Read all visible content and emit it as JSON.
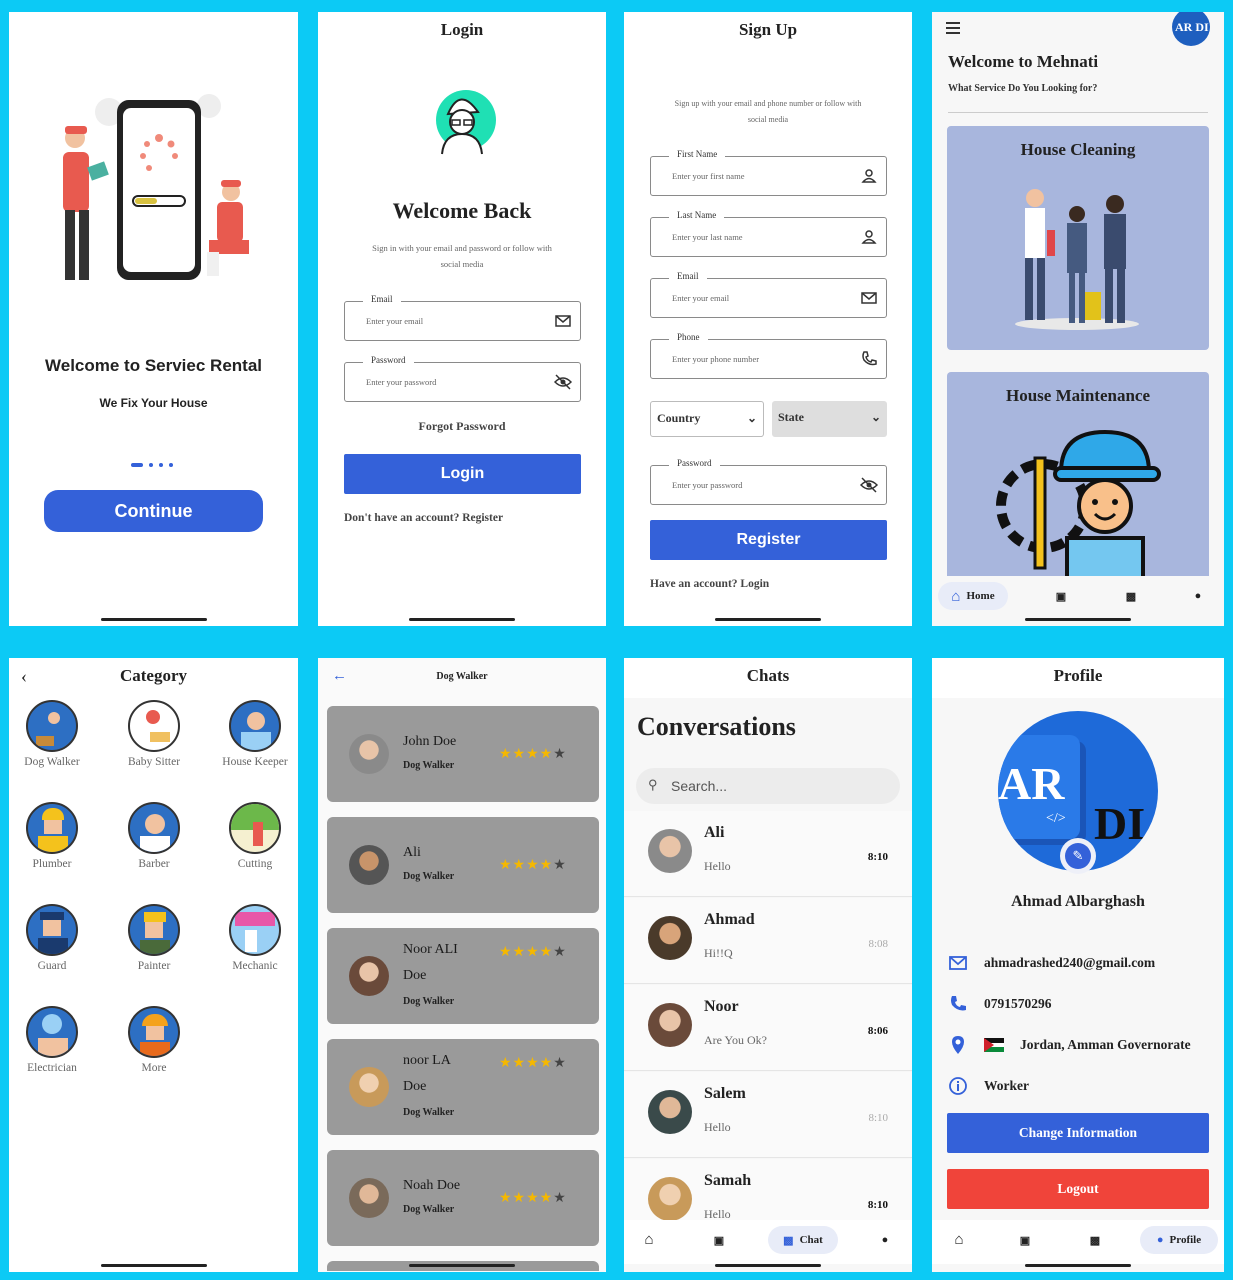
{
  "splash": {
    "title": "Welcome to Serviec Rental",
    "subtitle": "We Fix Your House",
    "continue": "Continue"
  },
  "login": {
    "title": "Login",
    "welcome": "Welcome Back",
    "desc": "Sign in with your email and password or follow with social media",
    "email_label": "Email",
    "email_placeholder": "Enter your email",
    "password_label": "Password",
    "password_placeholder": "Enter your password",
    "forgot": "Forgot Password",
    "button": "Login",
    "register": "Don't have an account? Register"
  },
  "signup": {
    "title": "Sign Up",
    "desc": "Sign up with your email and phone number or follow with social media",
    "fields": [
      {
        "label": "First Name",
        "placeholder": "Enter your first name",
        "icon": "person-icon"
      },
      {
        "label": "Last Name",
        "placeholder": "Enter your last name",
        "icon": "person-icon"
      },
      {
        "label": "Email",
        "placeholder": "Enter your email",
        "icon": "mail-icon"
      },
      {
        "label": "Phone",
        "placeholder": "Enter your phone number",
        "icon": "phone-icon"
      }
    ],
    "country": "Country",
    "state": "State",
    "password_label": "Password",
    "password_placeholder": "Enter your password",
    "button": "Register",
    "login_link": "Have an account? Login"
  },
  "home": {
    "avatar_text": "AR DI",
    "welcome": "Welcome to Mehnati",
    "question": "What Service Do You Looking for?",
    "cards": [
      "House Cleaning",
      "House Maintenance"
    ],
    "nav_home": "Home"
  },
  "category": {
    "title": "Category",
    "items": [
      "Dog Walker",
      "Baby Sitter",
      "House Keeper",
      "Plumber",
      "Barber",
      "Cutting",
      "Guard",
      "Painter",
      "Mechanic",
      "Electrician",
      "More"
    ]
  },
  "dogwalker": {
    "title": "Dog Walker",
    "workers": [
      {
        "name1": "John Doe",
        "name2": "",
        "role": "Dog Walker",
        "rating": 4.5
      },
      {
        "name1": "Ali",
        "name2": "",
        "role": "Dog Walker",
        "rating": 4.5
      },
      {
        "name1": "Noor ALI",
        "name2": "Doe",
        "role": "Dog Walker",
        "rating": 4.5
      },
      {
        "name1": "noor LA",
        "name2": "Doe",
        "role": "Dog Walker",
        "rating": 4.5
      },
      {
        "name1": "Noah Doe",
        "name2": "",
        "role": "Dog Walker",
        "rating": 4.5
      }
    ]
  },
  "chats": {
    "title": "Chats",
    "heading": "Conversations",
    "search_placeholder": "Search...",
    "items": [
      {
        "name": "Ali",
        "msg": "Hello",
        "time": "8:10",
        "unread": true
      },
      {
        "name": "Ahmad",
        "msg": "Hi!!Q",
        "time": "8:08",
        "unread": false
      },
      {
        "name": "Noor",
        "msg": "Are You Ok?",
        "time": "8:06",
        "unread": true
      },
      {
        "name": "Salem",
        "msg": "Hello",
        "time": "8:10",
        "unread": false
      },
      {
        "name": "Samah",
        "msg": "Hello",
        "time": "8:10",
        "unread": true
      }
    ],
    "nav_chat": "Chat"
  },
  "profile": {
    "title": "Profile",
    "avatar_text_1": "AR",
    "avatar_text_2": "DI",
    "name": "Ahmad Albarghash",
    "email": "ahmadrashed240@gmail.com",
    "phone": "0791570296",
    "location": "Jordan, Amman Governorate",
    "role": "Worker",
    "change": "Change Information",
    "logout": "Logout",
    "nav_profile": "Profile"
  },
  "colors": {
    "primary": "#3461d9",
    "logout": "#f0443a",
    "background": "#0ccaf5",
    "star": "#f5b800"
  }
}
